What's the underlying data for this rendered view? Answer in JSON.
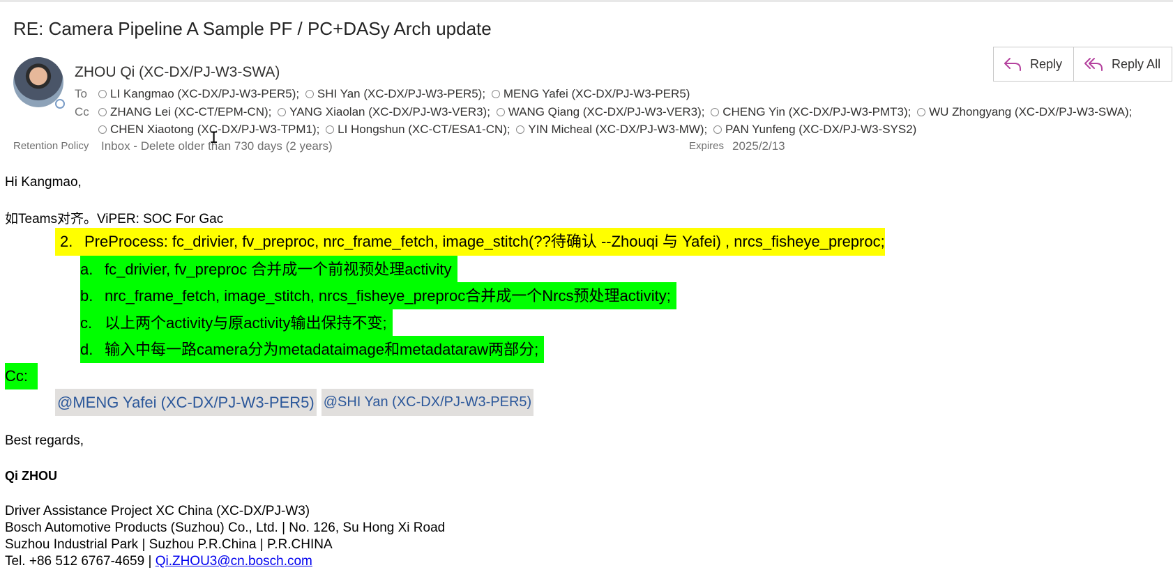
{
  "subject": "RE: Camera Pipeline A Sample PF / PC+DASy Arch update",
  "sender": "ZHOU Qi (XC-DX/PJ-W3-SWA)",
  "to_label": "To",
  "cc_label": "Cc",
  "to": [
    "LI Kangmao (XC-DX/PJ-W3-PER5);",
    "SHI Yan (XC-DX/PJ-W3-PER5);",
    "MENG Yafei (XC-DX/PJ-W3-PER5)"
  ],
  "cc_row1": [
    "ZHANG Lei (XC-CT/EPM-CN);",
    "YANG Xiaolan (XC-DX/PJ-W3-VER3);",
    "WANG Qiang (XC-DX/PJ-W3-VER3);",
    "CHENG Yin (XC-DX/PJ-W3-PMT3);",
    "WU Zhongyang (XC-DX/PJ-W3-SWA);"
  ],
  "cc_row2": [
    "CHEN Xiaotong (XC-DX/PJ-W3-TPM1);",
    "LI Hongshun (XC-CT/ESA1-CN);",
    "YIN Micheal (XC-DX/PJ-W3-MW);",
    "PAN Yunfeng (XC-DX/PJ-W3-SYS2)"
  ],
  "retention_label": "Retention Policy",
  "retention_value": "Inbox - Delete older than 730 days (2 years)",
  "expires_label": "Expires",
  "expires_value": "2025/2/13",
  "buttons": {
    "reply": "Reply",
    "reply_all": "Reply All"
  },
  "body": {
    "greeting": "Hi Kangmao,",
    "intro": "如Teams对齐。ViPER:   SOC For Gac",
    "item2_num": "2.",
    "item2_text": "PreProcess:   fc_drivier, fv_preproc, nrc_frame_fetch, image_stitch(??待确认 --Zhouqi 与 Yafei) ,  nrcs_fisheye_preproc;",
    "subitems": [
      {
        "letter": "a.",
        "text": "fc_drivier, fv_preproc 合并成一个前视预处理activity"
      },
      {
        "letter": "b.",
        "text": "nrc_frame_fetch, image_stitch,  nrcs_fisheye_preproc合并成一个Nrcs预处理activity;"
      },
      {
        "letter": "c.",
        "text": "以上两个activity与原activity输出保持不变;"
      },
      {
        "letter": "d.",
        "text": "输入中每一路camera分为metadataimage和metadataraw两部分;"
      }
    ],
    "cc": "Cc:",
    "mentions": [
      "@MENG Yafei (XC-DX/PJ-W3-PER5)",
      "@SHI Yan (XC-DX/PJ-W3-PER5)"
    ],
    "regards": "Best regards,",
    "sig_name": "Qi ZHOU",
    "sig_lines": [
      "Driver Assistance Project XC China (XC-DX/PJ-W3)",
      "Bosch Automotive Products (Suzhou) Co., Ltd. | No. 126, Su Hong Xi Road",
      "Suzhou Industrial Park | Suzhou P.R.China | P.R.CHINA"
    ],
    "tel": "Tel. +86 512 6767-4659 | ",
    "email": "Qi.ZHOU3@cn.bosch.com"
  }
}
